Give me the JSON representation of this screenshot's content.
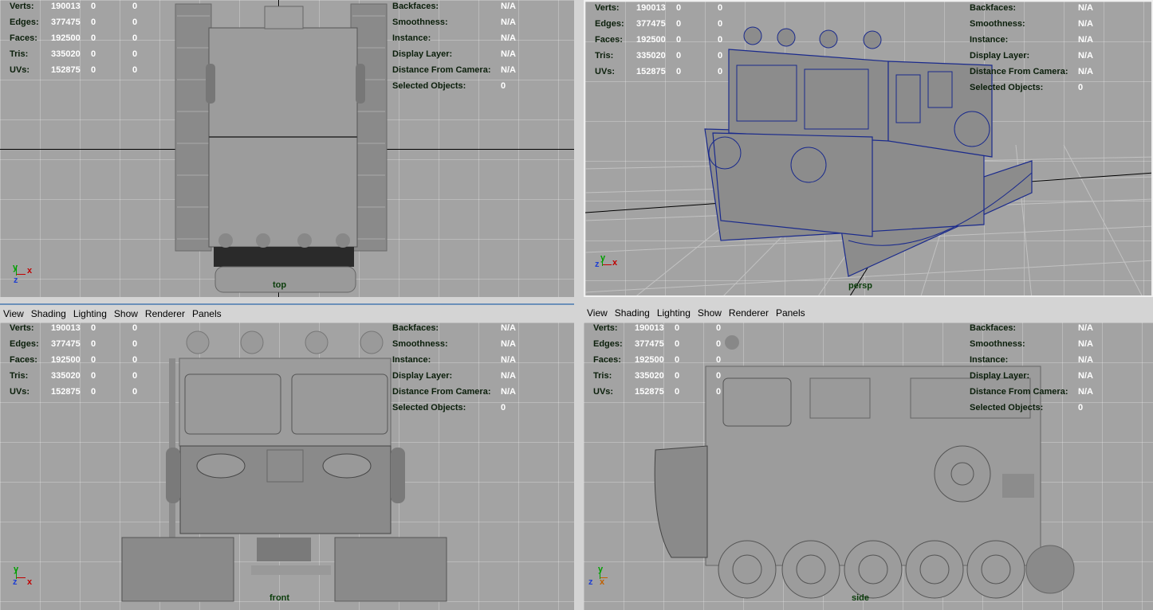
{
  "hud_stats": [
    {
      "label": "Verts:",
      "v1": "190013",
      "v2": "0",
      "v3": "0"
    },
    {
      "label": "Edges:",
      "v1": "377475",
      "v2": "0",
      "v3": "0"
    },
    {
      "label": "Faces:",
      "v1": "192500",
      "v2": "0",
      "v3": "0"
    },
    {
      "label": "Tris:",
      "v1": "335020",
      "v2": "0",
      "v3": "0"
    },
    {
      "label": "UVs:",
      "v1": "152875",
      "v2": "0",
      "v3": "0"
    }
  ],
  "hud_right": [
    {
      "label": "Backfaces:",
      "value": "N/A"
    },
    {
      "label": "Smoothness:",
      "value": "N/A"
    },
    {
      "label": "Instance:",
      "value": "N/A"
    },
    {
      "label": "Display Layer:",
      "value": "N/A"
    },
    {
      "label": "Distance From Camera:",
      "value": "N/A"
    },
    {
      "label": "Selected Objects:",
      "value": "0"
    }
  ],
  "menu": [
    "View",
    "Shading",
    "Lighting",
    "Show",
    "Renderer",
    "Panels"
  ],
  "cameras": {
    "top": "top",
    "persp": "persp",
    "front": "front",
    "side": "side"
  },
  "axes": {
    "x": "x",
    "y": "y",
    "z": "z"
  },
  "colors": {
    "viewport_bg": "#a3a3a3",
    "wire": "#1a2a8c",
    "axis_x": "#c00000",
    "axis_y": "#00a000",
    "axis_z": "#2040d0",
    "hud_label": "#0b1f0b",
    "hud_value": "#ffffff"
  }
}
